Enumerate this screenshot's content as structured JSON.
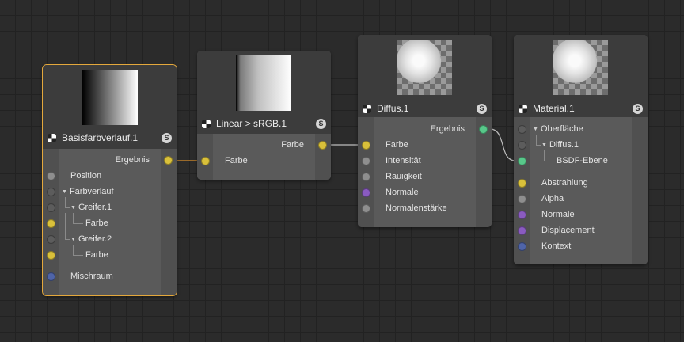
{
  "colors": {
    "yellow": "#d9c03a",
    "grey": "#8e8e8e",
    "dark": "#5c5c5c",
    "purple": "#8a5bc0",
    "blue": "#4f64a8",
    "green": "#58c88a",
    "selected": "#e4a83c"
  },
  "nodes": {
    "basis": {
      "title": "Basisfarbverlauf.1",
      "badge": "S",
      "output": "Ergebnis",
      "inputs": [
        "Position",
        "Farbverlauf",
        "Greifer.1",
        "Farbe",
        "Greifer.2",
        "Farbe",
        "Mischraum"
      ]
    },
    "linear": {
      "title": "Linear > sRGB.1",
      "badge": "S",
      "output": "Farbe",
      "inputs": [
        "Farbe"
      ]
    },
    "diffus": {
      "title": "Diffus.1",
      "badge": "S",
      "output": "Ergebnis",
      "inputs": [
        "Farbe",
        "Intensität",
        "Rauigkeit",
        "Normale",
        "Normalenstärke"
      ]
    },
    "material": {
      "title": "Material.1",
      "badge": "S",
      "inputs": [
        "Oberfläche",
        "Diffus.1",
        "BSDF-Ebene",
        "Abstrahlung",
        "Alpha",
        "Normale",
        "Displacement",
        "Kontext"
      ]
    }
  }
}
